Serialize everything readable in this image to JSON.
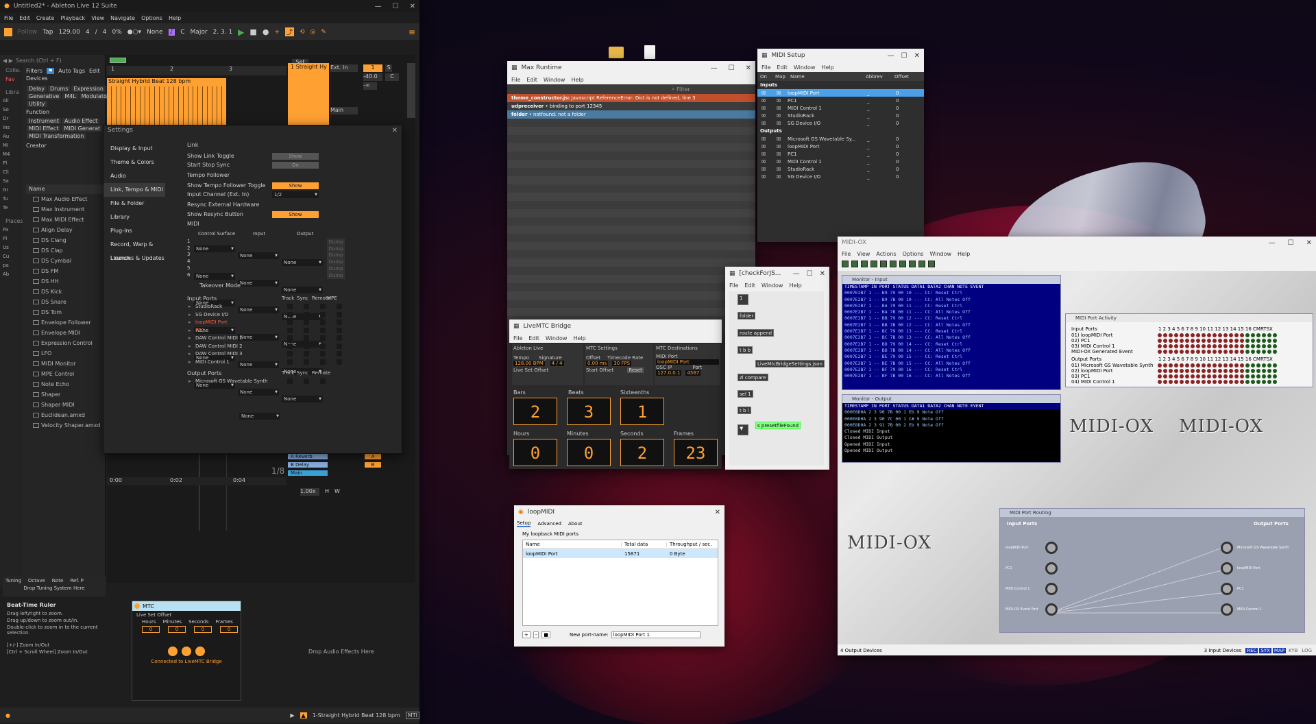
{
  "desktop": {
    "folder_icon": "folder-icon",
    "file_icon": "file-icon"
  },
  "ableton": {
    "title": "Untitled2* - Ableton Live 12 Suite",
    "menu": [
      "File",
      "Edit",
      "Create",
      "Playback",
      "View",
      "Navigate",
      "Options",
      "Help"
    ],
    "control": {
      "follow": "Follow",
      "tap": "Tap",
      "tempo": "129.00",
      "sig_num": "4",
      "sig_den": "4",
      "cpu": "0%",
      "quant": "None",
      "key": "C",
      "scale": "Major",
      "position": "2.  3.  1"
    },
    "search": {
      "placeholder": "Search (Ctrl + F)"
    },
    "collections": {
      "label": "Colle.",
      "fav": "Fav",
      "library": "Libra",
      "places": "Places"
    },
    "filters": {
      "label": "Filters",
      "auto_tags": "Auto Tags",
      "edit": "Edit",
      "devices": "Devices"
    },
    "tags_row1": [
      "Delay",
      "Drums",
      "Expression"
    ],
    "tags_row2": [
      "Generative",
      "M4L",
      "Modulator"
    ],
    "tags_row3": [
      "Utility"
    ],
    "function": "Function",
    "tags_row4": [
      "Instrument",
      "Audio Effect"
    ],
    "tags_row5": [
      "MIDI Effect",
      "MIDI Generat"
    ],
    "tags_row6": [
      "MIDI Transformation"
    ],
    "creator": "Creator",
    "name_col": "Name",
    "library_left": [
      "All",
      "So",
      "Dr",
      "Ins",
      "Au",
      "MI",
      "M4",
      "Pl",
      "Cli",
      "Sa",
      "Gr",
      "Tu",
      "Te"
    ],
    "places_left": [
      "Pa",
      "Pl",
      "Us",
      "Cu",
      "pa",
      "Ab"
    ],
    "browser_items": [
      "Max Audio Effect",
      "Max Instrument",
      "Max MIDI Effect",
      "Align Delay",
      "DS Clang",
      "DS Clap",
      "DS Cymbal",
      "DS FM",
      "DS HH",
      "DS Kick",
      "DS Snare",
      "DS Tom",
      "Envelope Follower",
      "Envelope MIDI",
      "Expression Control",
      "LFO",
      "MIDI Monitor",
      "MPE Control",
      "Note Echo",
      "Shaper",
      "Shaper MIDI",
      "Euclidean.amxd",
      "Velocity Shaper.amxd"
    ],
    "tuning": {
      "title": "Tuning",
      "octave": "Octave",
      "note": "Note",
      "ref": "Ref. P",
      "drop": "Drop Tuning System Here"
    },
    "info": {
      "title": "Beat-Time Ruler",
      "lines": [
        "Drag left/right to zoom.",
        "Drag up/down to zoom out/in.",
        "Double-click to zoom in to the current selection.",
        "",
        "[+/-] Zoom In/Out",
        "[Ctrl + Scroll Wheel] Zoom In/Out"
      ]
    },
    "arrangement": {
      "ruler": [
        "1",
        "2",
        "3"
      ],
      "set": "Set",
      "clip_name": "Straight Hybrid Beat 128 bpm",
      "track1": "1 Straight Hy",
      "ext_in": "Ext. In",
      "main": "Main",
      "vol": "-40.0",
      "pan": "C",
      "auto": "Auto",
      "off": "Off",
      "in": "In",
      "all_ins": "All Ins",
      "all_channels": "All Channi",
      "loopmidi": "loopMIDI Po",
      "ch2": "Ch. 2",
      "pc1": "PC1",
      "track2_num": "2",
      "track3_num": "3",
      "inf": "-∞"
    },
    "returns": [
      {
        "name": "A Reverb",
        "letter": "A"
      },
      {
        "name": "B Delay",
        "letter": "B"
      },
      {
        "name": "Main",
        "letter": ""
      }
    ],
    "bottom": {
      "time1": "0:00",
      "time2": "0:02",
      "time3": "0:04",
      "ratio": "1/8",
      "zoom": "1.00x",
      "half": "1/2",
      "main_val": "0",
      "db": "-6.0",
      "H": "H",
      "W": "W",
      "status_clip": "1-Straight Hybrid Beat 128 bpm",
      "mti": "MTI"
    },
    "device": {
      "title": "MTC",
      "live_set_offset": "Live Set Offset",
      "hours": "Hours",
      "minutes": "Minutes",
      "seconds": "Seconds",
      "frames": "Frames",
      "h_val": "0",
      "m_val": "0",
      "s_val": "0",
      "f_val": "0",
      "status": "Connected to LiveMTC Bridge",
      "drop": "Drop Audio Effects Here"
    }
  },
  "settings": {
    "title": "Settings",
    "nav": [
      "Display & Input",
      "Theme & Colors",
      "Audio",
      "Link, Tempo & MIDI",
      "File & Folder",
      "Library",
      "Plug-Ins",
      "Record, Warp & Launch",
      "Licenses & Updates"
    ],
    "link": "Link",
    "show_link": "Show Link Toggle",
    "show": "Show",
    "start_stop": "Start Stop Sync",
    "on": "On",
    "tempo_follower": "Tempo Follower",
    "show_tf": "Show Tempo Follower Toggle",
    "input_ch": "Input Channel (Ext. In)",
    "input_ch_val": "1/2",
    "resync": "Resync External Hardware",
    "show_resync": "Show Resync Button",
    "midi": "MIDI",
    "cs": "Control Surface",
    "input": "Input",
    "output": "Output",
    "none": "None",
    "dump": "Dump",
    "takeover": "Takeover Mode",
    "takeover_val": "None",
    "input_ports": "Input Ports",
    "track": "Track",
    "sync": "Sync",
    "remote": "Remote",
    "mpe": "MPE",
    "in_ports": [
      "StudioRack",
      "SG Device I/O",
      "loopMIDI Port",
      "PC1",
      "DAW Control MIDI 1",
      "DAW Control MIDI 2",
      "DAW Control MIDI 3",
      "MIDI Control 1"
    ],
    "output_ports": "Output Ports",
    "out_ports": [
      "Microsoft GS Wavetable Synth"
    ]
  },
  "maxrt": {
    "title": "Max Runtime",
    "menu": [
      "File",
      "Edit",
      "Window",
      "Help"
    ],
    "filter": "Filter",
    "log": [
      {
        "src": "theme_constructor.js:",
        "msg": "Javascript ReferenceError: Dict is not defined, line 3"
      },
      {
        "src": "udpreceiver",
        "msg": "• binding to port 12345"
      },
      {
        "src": "folder",
        "msg": "• notfound: not a folder"
      }
    ]
  },
  "livemtc": {
    "title": "LiveMTC Bridge",
    "menu": [
      "File",
      "Edit",
      "Window",
      "Help"
    ],
    "panel1": "Ableton Live",
    "tempo": "Tempo",
    "tempo_val": "128.00 BPM",
    "signature": "Signature",
    "sig_val": "4 / 4",
    "lso": "Live Set Offset",
    "panel2": "MTC Settings",
    "offset": "Offset",
    "offset_val": "0.00 ms",
    "tc_rate": "Timecode Rate",
    "tc_val": "30 FPS",
    "start_offset": "Start Offset",
    "reset": "Reset",
    "panel3": "MTC Destinations",
    "midi_port": "MIDI Port",
    "midi_port_val": "loopMIDI Port",
    "osc_ip": "OSC IP",
    "osc_ip_val": "127.0.0.1",
    "port": "Port",
    "port_val": "4567",
    "bars": "Bars",
    "beats": "Beats",
    "sixteenths": "Sixteenths",
    "bars_v": "2",
    "beats_v": "3",
    "six_v": "1",
    "hours": "Hours",
    "minutes": "Minutes",
    "seconds": "Seconds",
    "frames": "Frames",
    "h_v": "0",
    "m_v": "0",
    "s_v": "2",
    "f_v": "23"
  },
  "patcher": {
    "title": "[checkForJS...",
    "menu": [
      "File",
      "Edit",
      "Window",
      "Help"
    ],
    "boxes": [
      "1",
      "folder",
      "route append",
      "t b b",
      "LiveMtcBridgeSettings.json",
      "zl compare",
      "sel 1",
      "t b l",
      "s presetfileFound"
    ]
  },
  "midisetup": {
    "title": "MIDI Setup",
    "menu": [
      "File",
      "Edit",
      "Window",
      "Help"
    ],
    "cols": [
      "On",
      "Map",
      "Name",
      "Abbrev",
      "Offset"
    ],
    "inputs": "Inputs",
    "in_list": [
      "loopMIDI Port",
      "PC1",
      "MIDI Control 1",
      "StudioRack",
      "SG Device I/O"
    ],
    "outputs": "Outputs",
    "out_list": [
      "Microsoft GS Wavetable Sy...",
      "loopMIDI Port",
      "PC1",
      "MIDI Control 1",
      "StudioRack",
      "SG Device I/O"
    ],
    "offset": "0",
    "abbr": "_"
  },
  "midiox": {
    "title": "MIDI-OX",
    "menu": [
      "File",
      "View",
      "Actions",
      "Options",
      "Window",
      "Help"
    ],
    "monin_title": "Monitor - Input",
    "monout_title": "Monitor - Output",
    "mon_header": "TIMESTAMP IN PORT STATUS DATA1 DATA2 CHAN NOTE EVENT",
    "monin_rows": [
      "0007E2B7  1  --   B9   79   00   10  ---  CC: Reset Ctrl",
      "0007E2B7  1  --   B9   7B   00   10  ---  CC: All Notes Off",
      "0007E2B7  1  --   BA   79   00   11  ---  CC: Reset Ctrl",
      "0007E2B7  1  --   BA   7B   00   11  ---  CC: All Notes Off",
      "0007E2B7  1  --   BB   79   00   12  ---  CC: Reset Ctrl",
      "0007E2B7  1  --   BB   7B   00   12  ---  CC: All Notes Off",
      "0007E2B7  1  --   BC   79   00   13  ---  CC: Reset Ctrl",
      "0007E2B7  1  --   BC   7B   00   13  ---  CC: All Notes Off",
      "0007E2B7  1  --   BD   79   00   14  ---  CC: Reset Ctrl",
      "0007E2B7  1  --   BD   7B   00   14  ---  CC: All Notes Off",
      "0007E2B7  1  --   BE   79   00   15  ---  CC: Reset Ctrl",
      "0007E2B7  1  --   BE   7B   00   15  ---  CC: All Notes Off",
      "0007E2B7  1  --   BF   79   00   16  ---  CC: Reset Ctrl",
      "0007E2B7  1  --   BF   7B   00   16  ---  CC: All Notes Off"
    ],
    "monout_rows": [
      "000E8D0A  2  3   90   7B   00   1  Eb 9 Note Off",
      "000E8D0A  2  3   90   7C   00   1  C# 9 Note Off",
      "000E8D0A  2  3   91   7B   00   2  Eb 9 Note Off",
      "Closed MIDI Input",
      "Closed MIDI Output",
      "Opened MIDI Input",
      "Opened MIDI Output"
    ],
    "activity_title": "MIDI Port Activity",
    "input_ports": "Input Ports",
    "in_list": [
      "01) loopMIDI Port",
      "02) PC1",
      "03) MIDI Control 1",
      "MIDI-OX Generated Event"
    ],
    "output_ports": "Output Ports",
    "out_list": [
      "01) Microsoft GS Wavetable Synth",
      "02) loopMIDI Port",
      "03) PC1",
      "04) MIDI Control 1"
    ],
    "ch_header": "1 2 3 4 5 6 7 8 9 10 11 12 13 14 15 16 CMRTSX",
    "logo": "MIDI-OX",
    "routing_title": "MIDI Port Routing",
    "r_in": "Input Ports",
    "r_out": "Output Ports",
    "r_in_list": [
      "loopMIDI Port",
      "PC1",
      "MIDI Control 1",
      "MIDI-OX Event Port"
    ],
    "r_out_list": [
      "Microsoft GS Wavetable Synth",
      "loopMIDI Port",
      "PC1",
      "MIDI Control 1"
    ],
    "status_left": "4 Output Devices",
    "status_right": "3 Input Devices",
    "flags": [
      "REC",
      "SYX",
      "MAP",
      "KYB",
      "LOG"
    ]
  },
  "loopmidi": {
    "title": "loopMIDI",
    "tabs": [
      "Setup",
      "Advanced",
      "About"
    ],
    "group": "My loopback MIDI ports",
    "cols": [
      "Name",
      "Total data",
      "Throughput / sec."
    ],
    "row": {
      "name": "loopMIDI Port",
      "total": "15871",
      "throughput": "0 Byte"
    },
    "new_label": "New port-name:",
    "new_val": "loopMIDI Port 1",
    "plus": "+",
    "minus": "-"
  }
}
